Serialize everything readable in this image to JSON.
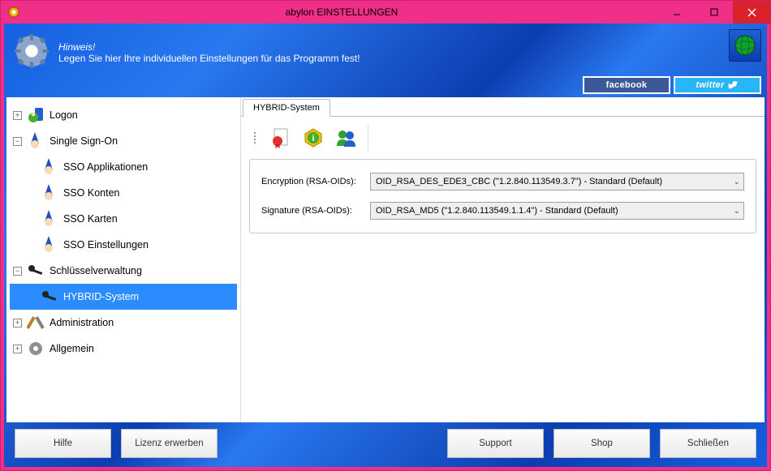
{
  "window": {
    "title": "abylon EINSTELLUNGEN"
  },
  "header": {
    "hint_title": "Hinweis!",
    "hint_text": "Legen Sie hier Ihre individuellen Einstellungen für das Programm fest!"
  },
  "social": {
    "facebook": "facebook",
    "twitter": "twitter"
  },
  "tree": {
    "logon": "Logon",
    "sso": "Single Sign-On",
    "sso_apps": "SSO Applikationen",
    "sso_accounts": "SSO Konten",
    "sso_cards": "SSO Karten",
    "sso_settings": "SSO Einstellungen",
    "keys": "Schlüsselverwaltung",
    "hybrid": "HYBRID-System",
    "admin": "Administration",
    "general": "Allgemein"
  },
  "tab": {
    "label": "HYBRID-System"
  },
  "form": {
    "enc_label": "Encryption (RSA-OIDs):",
    "enc_value": "OID_RSA_DES_EDE3_CBC (\"1.2.840.113549.3.7\") - Standard (Default)",
    "sig_label": "Signature  (RSA-OIDs):",
    "sig_value": "OID_RSA_MD5 (\"1.2.840.113549.1.1.4\") - Standard (Default)"
  },
  "footer": {
    "help": "Hilfe",
    "license": "Lizenz erwerben",
    "support": "Support",
    "shop": "Shop",
    "close": "Schließen"
  }
}
